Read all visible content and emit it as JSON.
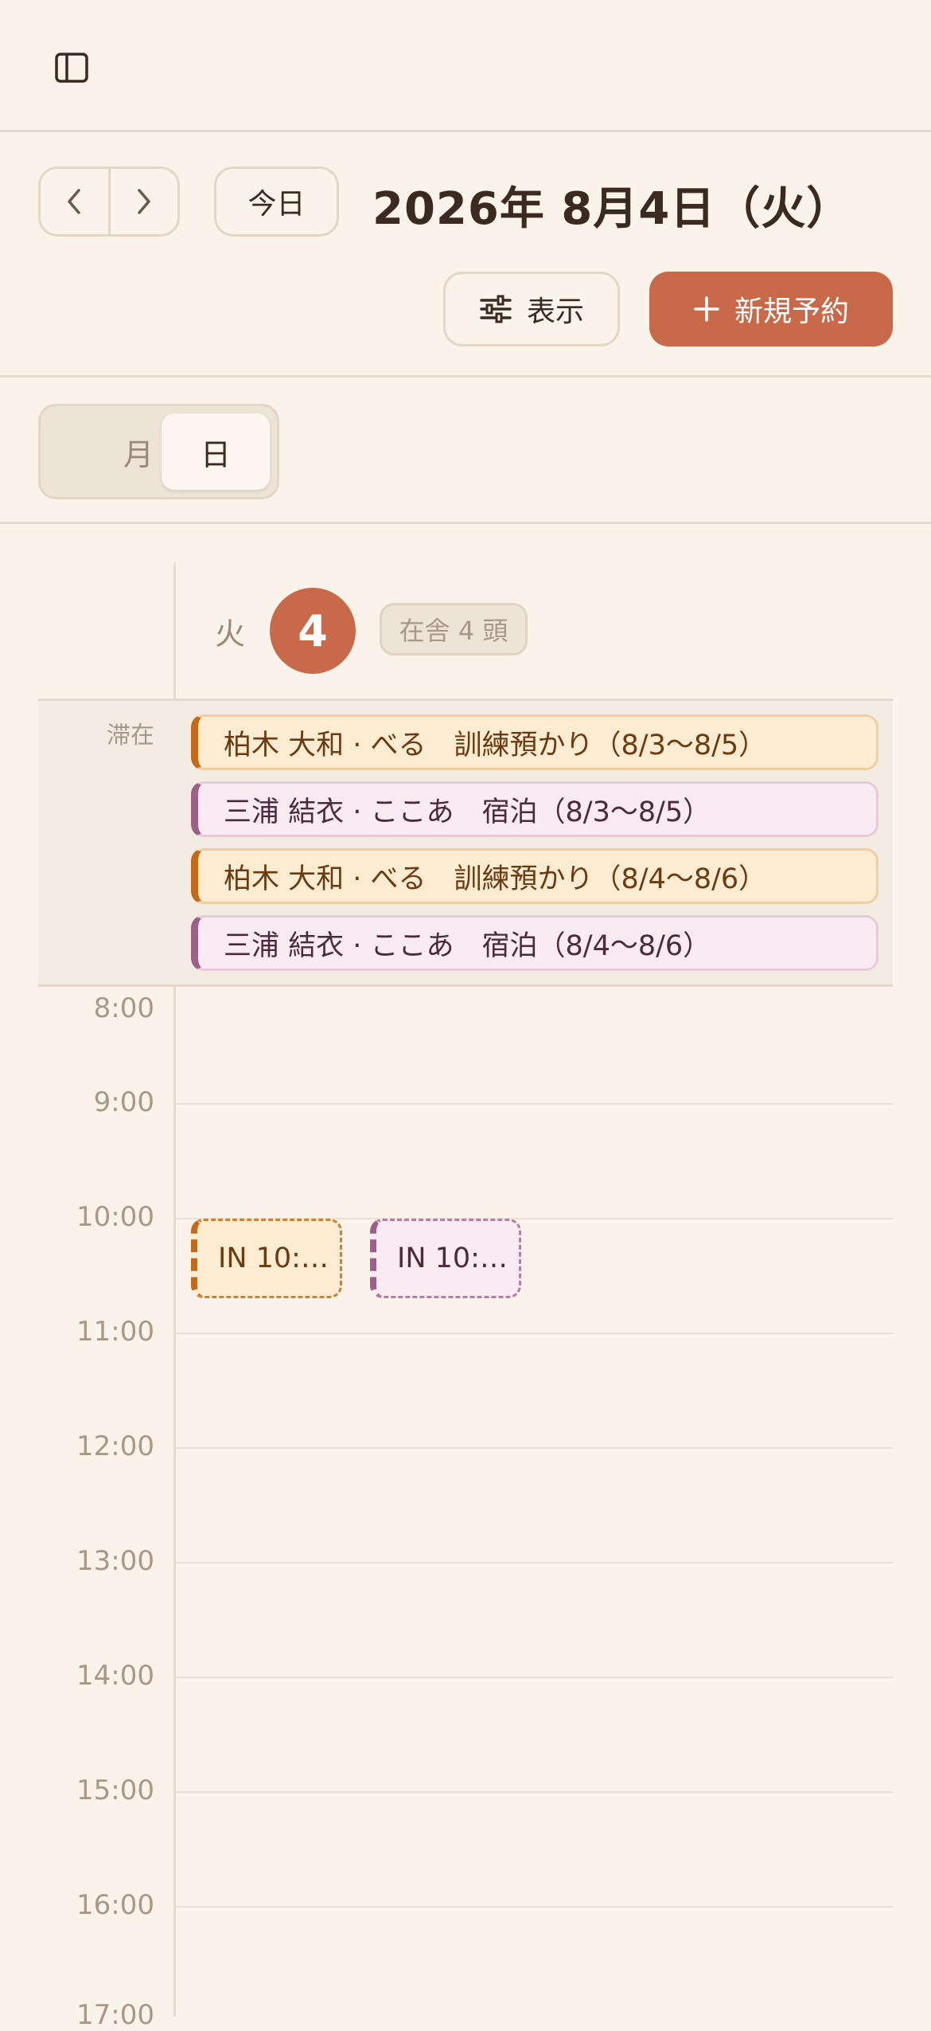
{
  "header": {
    "sidebar_icon": "sidebar-toggle-icon"
  },
  "toolbar": {
    "prev_icon": "chevron-left-icon",
    "next_icon": "chevron-right-icon",
    "today_label": "今日",
    "date_title": "2026年 8月4日（火）",
    "view_label": "表示",
    "view_icon": "sliders-icon",
    "new_label": "新規予約",
    "new_icon": "plus-icon"
  },
  "view_switch": {
    "month_label": "月",
    "day_label": "日",
    "selected": "日"
  },
  "day_header": {
    "weekday": "火",
    "day_number": "4",
    "occupancy": "在舎 4 頭"
  },
  "stays": {
    "label": "滞在",
    "items": [
      {
        "text": "柏木 大和 · べる　訓練預かり（8/3〜8/5）",
        "color": "#C46A16"
      },
      {
        "text": "三浦 結衣 · ここあ　宿泊（8/3〜8/5）",
        "color": "#9C5F86"
      },
      {
        "text": "柏木 大和 · べる　訓練預かり（8/4〜8/6）",
        "color": "#C46A16"
      },
      {
        "text": "三浦 結衣 · ここあ　宿泊（8/4〜8/6）",
        "color": "#9C5F86"
      }
    ]
  },
  "hours": [
    "8:00",
    "9:00",
    "10:00",
    "11:00",
    "12:00",
    "13:00",
    "14:00",
    "15:00",
    "16:00",
    "17:00"
  ],
  "timed_events": [
    {
      "text": "IN 10:…",
      "color": "#C46A16"
    },
    {
      "text": "IN 10:…",
      "color": "#9C5F86"
    }
  ],
  "colors": {
    "accent": "#C8694A",
    "background": "#FAF3EA",
    "training": "#C46A16",
    "boarding": "#9C5F86"
  }
}
